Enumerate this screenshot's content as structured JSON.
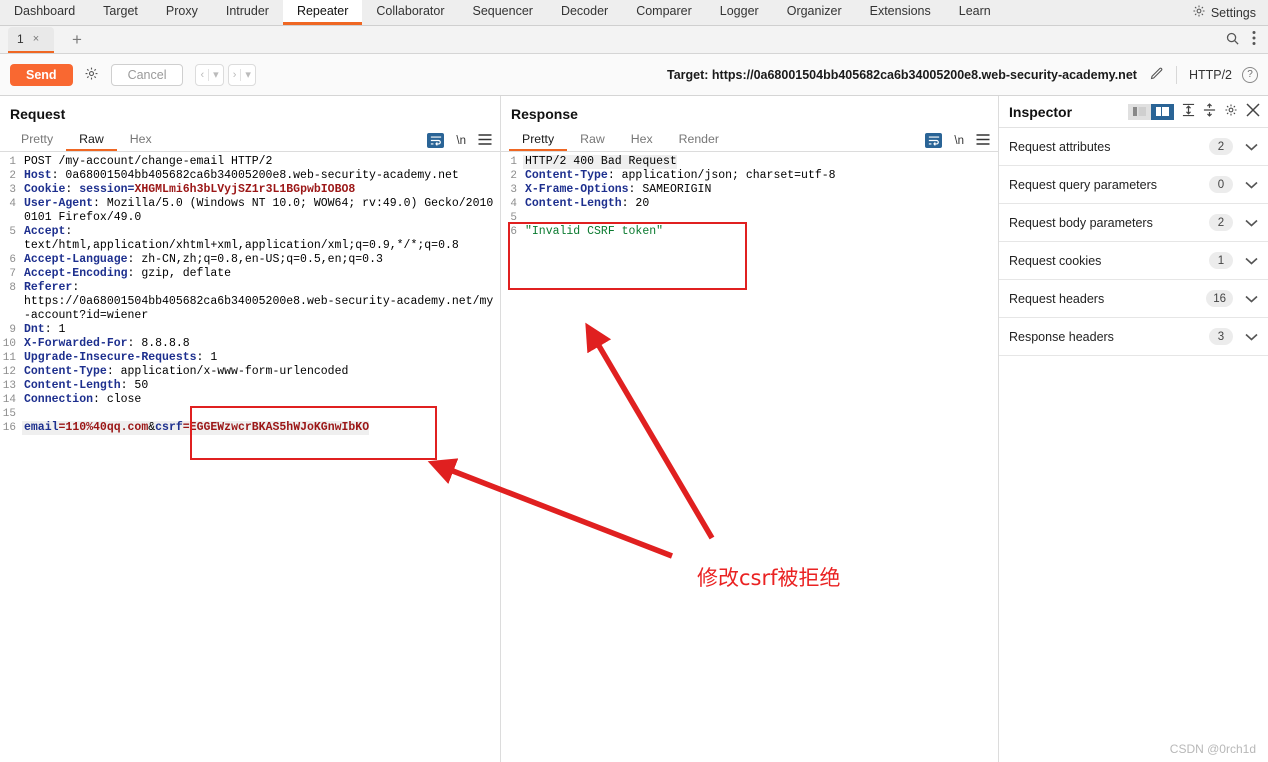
{
  "menubar": {
    "items": [
      {
        "label": "Dashboard",
        "active": false
      },
      {
        "label": "Target",
        "active": false
      },
      {
        "label": "Proxy",
        "active": false
      },
      {
        "label": "Intruder",
        "active": false
      },
      {
        "label": "Repeater",
        "active": true
      },
      {
        "label": "Collaborator",
        "active": false
      },
      {
        "label": "Sequencer",
        "active": false
      },
      {
        "label": "Decoder",
        "active": false
      },
      {
        "label": "Comparer",
        "active": false
      },
      {
        "label": "Logger",
        "active": false
      },
      {
        "label": "Organizer",
        "active": false
      },
      {
        "label": "Extensions",
        "active": false
      },
      {
        "label": "Learn",
        "active": false
      }
    ],
    "settings_label": "Settings",
    "settings_icon": "gear-icon"
  },
  "tabstrip": {
    "tab_number": "1",
    "close_glyph": "×",
    "add_glyph": "+",
    "search_icon": "search-icon",
    "more_icon": "kebab-menu-icon"
  },
  "actionbar": {
    "send_label": "Send",
    "settings_icon": "gear-icon",
    "cancel_label": "Cancel",
    "prev_glyph": "‹",
    "next_glyph": "›",
    "caret_glyph": "▾",
    "target_label": "Target: https://0a68001504bb405682ca6b34005200e8.web-security-academy.net",
    "edit_icon": "pencil-icon",
    "protocol": "HTTP/2",
    "help_glyph": "?"
  },
  "request": {
    "title": "Request",
    "tabs": [
      {
        "label": "Pretty",
        "active": false
      },
      {
        "label": "Raw",
        "active": true
      },
      {
        "label": "Hex",
        "active": false
      }
    ],
    "wrap_icon": "word-wrap-icon",
    "newline_label": "\\n",
    "menu_icon": "hamburger-menu-icon",
    "lines": [
      {
        "n": "1",
        "parts": [
          {
            "t": "POST /my-account/change-email HTTP/2",
            "c": "val"
          }
        ]
      },
      {
        "n": "2",
        "parts": [
          {
            "t": "Host",
            "c": "hdr"
          },
          {
            "t": ": 0a68001504bb405682ca6b34005200e8.web-security-academy.net",
            "c": "val"
          }
        ]
      },
      {
        "n": "3",
        "parts": [
          {
            "t": "Cookie",
            "c": "hdr"
          },
          {
            "t": ": ",
            "c": "val"
          },
          {
            "t": "session=",
            "c": "hdr"
          },
          {
            "t": "XHGMLmi6h3bLVyjSZ1r3L1BGpwbIOBO8",
            "c": "redv"
          }
        ]
      },
      {
        "n": "4",
        "parts": [
          {
            "t": "User-Agent",
            "c": "hdr"
          },
          {
            "t": ": Mozilla/5.0 (Windows NT 10.0; WOW64; rv:49.0) Gecko/20100101 Firefox/49.0",
            "c": "val"
          }
        ]
      },
      {
        "n": "5",
        "parts": [
          {
            "t": "Accept",
            "c": "hdr"
          },
          {
            "t": ": \ntext/html,application/xhtml+xml,application/xml;q=0.9,*/*;q=0.8",
            "c": "val"
          }
        ]
      },
      {
        "n": "6",
        "parts": [
          {
            "t": "Accept-Language",
            "c": "hdr"
          },
          {
            "t": ": zh-CN,zh;q=0.8,en-US;q=0.5,en;q=0.3",
            "c": "val"
          }
        ]
      },
      {
        "n": "7",
        "parts": [
          {
            "t": "Accept-Encoding",
            "c": "hdr"
          },
          {
            "t": ": gzip, deflate",
            "c": "val"
          }
        ]
      },
      {
        "n": "8",
        "parts": [
          {
            "t": "Referer",
            "c": "hdr"
          },
          {
            "t": ": \nhttps://0a68001504bb405682ca6b34005200e8.web-security-academy.net/my-account?id=wiener",
            "c": "val"
          }
        ]
      },
      {
        "n": "9",
        "parts": [
          {
            "t": "Dnt",
            "c": "hdr"
          },
          {
            "t": ": 1",
            "c": "val"
          }
        ]
      },
      {
        "n": "10",
        "parts": [
          {
            "t": "X-Forwarded-For",
            "c": "hdr"
          },
          {
            "t": ": 8.8.8.8",
            "c": "val"
          }
        ]
      },
      {
        "n": "11",
        "parts": [
          {
            "t": "Upgrade-Insecure-Requests",
            "c": "hdr"
          },
          {
            "t": ": 1",
            "c": "val"
          }
        ]
      },
      {
        "n": "12",
        "parts": [
          {
            "t": "Content-Type",
            "c": "hdr"
          },
          {
            "t": ": application/x-www-form-urlencoded",
            "c": "val"
          }
        ]
      },
      {
        "n": "13",
        "parts": [
          {
            "t": "Content-Length",
            "c": "hdr"
          },
          {
            "t": ": 50",
            "c": "val"
          }
        ]
      },
      {
        "n": "14",
        "parts": [
          {
            "t": "Connection",
            "c": "hdr"
          },
          {
            "t": ": close",
            "c": "val"
          }
        ]
      },
      {
        "n": "15",
        "parts": [
          {
            "t": "",
            "c": "val"
          }
        ]
      },
      {
        "n": "16",
        "highlight": true,
        "parts": [
          {
            "t": "email",
            "c": "hdr"
          },
          {
            "t": "=",
            "c": "redv"
          },
          {
            "t": "110%40qq.com",
            "c": "redv"
          },
          {
            "t": "&",
            "c": "val"
          },
          {
            "t": "csrf",
            "c": "hdr"
          },
          {
            "t": "=",
            "c": "redv"
          },
          {
            "t": "EGGEWzwcrBKAS5hWJoKGnwIbKO",
            "c": "redv"
          }
        ]
      }
    ]
  },
  "response": {
    "title": "Response",
    "view_toggle": [
      {
        "icon": "split-vertical-icon",
        "active": true
      },
      {
        "icon": "split-horizontal-icon",
        "active": false
      },
      {
        "icon": "single-pane-icon",
        "active": false
      }
    ],
    "tabs": [
      {
        "label": "Pretty",
        "active": true
      },
      {
        "label": "Raw",
        "active": false
      },
      {
        "label": "Hex",
        "active": false
      },
      {
        "label": "Render",
        "active": false
      }
    ],
    "wrap_icon": "word-wrap-icon",
    "newline_label": "\\n",
    "menu_icon": "hamburger-menu-icon",
    "lines": [
      {
        "n": "1",
        "highlight": true,
        "parts": [
          {
            "t": "HTTP/2 400 Bad Request",
            "c": "val"
          }
        ]
      },
      {
        "n": "2",
        "parts": [
          {
            "t": "Content-Type",
            "c": "hdr"
          },
          {
            "t": ": application/json; charset=utf-8",
            "c": "val"
          }
        ]
      },
      {
        "n": "3",
        "parts": [
          {
            "t": "X-Frame-Options",
            "c": "hdr"
          },
          {
            "t": ": SAMEORIGIN",
            "c": "val"
          }
        ]
      },
      {
        "n": "4",
        "parts": [
          {
            "t": "Content-Length",
            "c": "hdr"
          },
          {
            "t": ": 20",
            "c": "val"
          }
        ]
      },
      {
        "n": "5",
        "parts": [
          {
            "t": "",
            "c": "val"
          }
        ]
      },
      {
        "n": "6",
        "parts": [
          {
            "t": "\"Invalid CSRF token\"",
            "c": "grn"
          }
        ]
      }
    ]
  },
  "inspector": {
    "title": "Inspector",
    "seg_icons": [
      {
        "icon": "panel-left-icon",
        "active": false
      },
      {
        "icon": "panel-right-icon",
        "active": true
      }
    ],
    "expand_icon": "expand-all-icon",
    "collapse_icon": "collapse-all-icon",
    "gear_icon": "gear-icon",
    "close_icon": "close-icon",
    "sections": [
      {
        "label": "Request attributes",
        "count": "2",
        "chevron": "chevron-down-icon"
      },
      {
        "label": "Request query parameters",
        "count": "0",
        "chevron": "chevron-down-icon"
      },
      {
        "label": "Request body parameters",
        "count": "2",
        "chevron": "chevron-down-icon"
      },
      {
        "label": "Request cookies",
        "count": "1",
        "chevron": "chevron-down-icon"
      },
      {
        "label": "Request headers",
        "count": "16",
        "chevron": "chevron-down-icon"
      },
      {
        "label": "Response headers",
        "count": "3",
        "chevron": "chevron-down-icon"
      }
    ]
  },
  "annotations": {
    "note_text": "修改csrf被拒绝",
    "note_color": "#ea2222",
    "box_color": "#e02020",
    "arrow_color": "#e02020"
  },
  "watermark": {
    "text": "CSDN @0rch1d"
  },
  "colors": {
    "accent_orange": "#ef6723",
    "send_orange": "#f96831",
    "blue_active": "#2a6496",
    "header_blue": "#1d2f8e",
    "value_red": "#9b1616",
    "string_green": "#0a7a2f"
  }
}
